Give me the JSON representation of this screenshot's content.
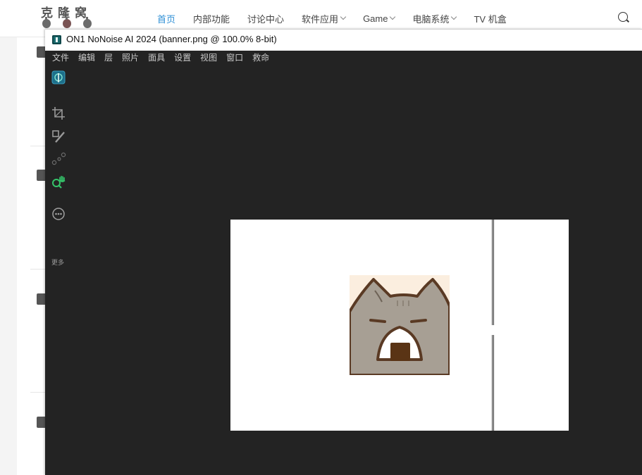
{
  "site": {
    "logo_text": "克隆窝",
    "nav": [
      {
        "label": "首页",
        "active": true,
        "has_dropdown": false
      },
      {
        "label": "内部功能",
        "active": false,
        "has_dropdown": false
      },
      {
        "label": "讨论中心",
        "active": false,
        "has_dropdown": false
      },
      {
        "label": "软件应用",
        "active": false,
        "has_dropdown": true
      },
      {
        "label": "Game",
        "active": false,
        "has_dropdown": true
      },
      {
        "label": "电脑系统",
        "active": false,
        "has_dropdown": true
      },
      {
        "label": "TV 机盒",
        "active": false,
        "has_dropdown": false
      }
    ],
    "icons": {
      "search": "search-icon"
    },
    "colors": {
      "nav_active": "#2e8fd6"
    }
  },
  "app": {
    "title": "ON1 NoNoise AI 2024 (banner.png @ 100.0% 8-bit)",
    "menu": [
      "文件",
      "编辑",
      "层",
      "照片",
      "面具",
      "设置",
      "视图",
      "窗口",
      "救命"
    ],
    "tools": [
      {
        "name": "app-logo-icon"
      },
      {
        "name": "crop-icon"
      },
      {
        "name": "retouch-brush-icon"
      },
      {
        "name": "nodes-icon"
      },
      {
        "name": "zoom-hand-icon",
        "active": true
      },
      {
        "name": "more-icon"
      }
    ],
    "more_label": "更多",
    "colors": {
      "background": "#232323",
      "active_tool": "#35c46a"
    }
  },
  "canvas": {
    "image_description_icon": "cat-rice-ball-icon"
  }
}
